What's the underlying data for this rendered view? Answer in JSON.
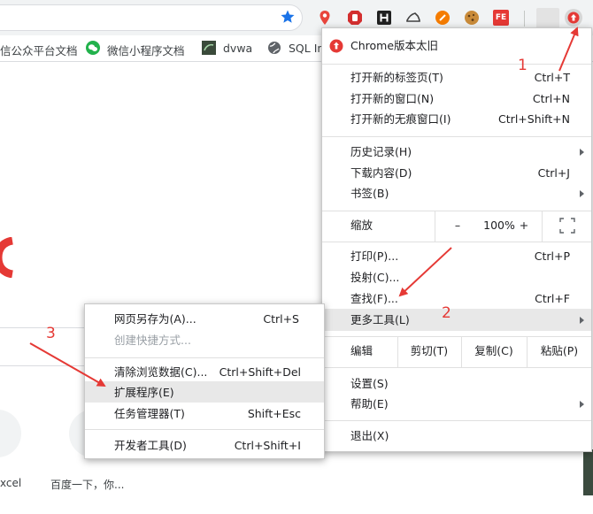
{
  "colors": {
    "accent": "#1a73e8",
    "annotation": "#e53935",
    "highlight": "#e8e8e8"
  },
  "bookmarks": [
    {
      "label": "信公众平台文档",
      "icon": "globe-icon"
    },
    {
      "label": "微信小程序文档",
      "icon": "wechat-icon"
    },
    {
      "label": "dvwa",
      "icon": "dvwa-icon"
    },
    {
      "label": "SQL In",
      "icon": "globe-icon"
    }
  ],
  "extensions": {
    "fe_label": "FE"
  },
  "menu": {
    "header": "Chrome版本太旧",
    "new_tab": {
      "label": "打开新的标签页(T)",
      "shortcut": "Ctrl+T"
    },
    "new_window": {
      "label": "打开新的窗口(N)",
      "shortcut": "Ctrl+N"
    },
    "incognito": {
      "label": "打开新的无痕窗口(I)",
      "shortcut": "Ctrl+Shift+N"
    },
    "history": {
      "label": "历史记录(H)"
    },
    "downloads": {
      "label": "下载内容(D)",
      "shortcut": "Ctrl+J"
    },
    "bookmarks": {
      "label": "书签(B)"
    },
    "zoom": {
      "label": "缩放",
      "minus": "–",
      "value": "100%",
      "plus": "+"
    },
    "print": {
      "label": "打印(P)...",
      "shortcut": "Ctrl+P"
    },
    "cast": {
      "label": "投射(C)..."
    },
    "find": {
      "label": "查找(F)...",
      "shortcut": "Ctrl+F"
    },
    "more_tools": {
      "label": "更多工具(L)"
    },
    "edit": {
      "label": "编辑",
      "cut": "剪切(T)",
      "copy": "复制(C)",
      "paste": "粘贴(P)"
    },
    "settings": {
      "label": "设置(S)"
    },
    "help": {
      "label": "帮助(E)"
    },
    "exit": {
      "label": "退出(X)"
    }
  },
  "submenu": {
    "save_as": {
      "label": "网页另存为(A)...",
      "shortcut": "Ctrl+S"
    },
    "create_shortcut": {
      "label": "创建快捷方式..."
    },
    "clear_data": {
      "label": "清除浏览数据(C)...",
      "shortcut": "Ctrl+Shift+Del"
    },
    "extensions": {
      "label": "扩展程序(E)"
    },
    "task_manager": {
      "label": "任务管理器(T)",
      "shortcut": "Shift+Esc"
    },
    "dev_tools": {
      "label": "开发者工具(D)",
      "shortcut": "Ctrl+Shift+I"
    }
  },
  "tiles": [
    {
      "label": "xcel"
    },
    {
      "label": "百度一下，你..."
    }
  ],
  "annotations": {
    "a1": "1",
    "a2": "2",
    "a3": "3"
  }
}
